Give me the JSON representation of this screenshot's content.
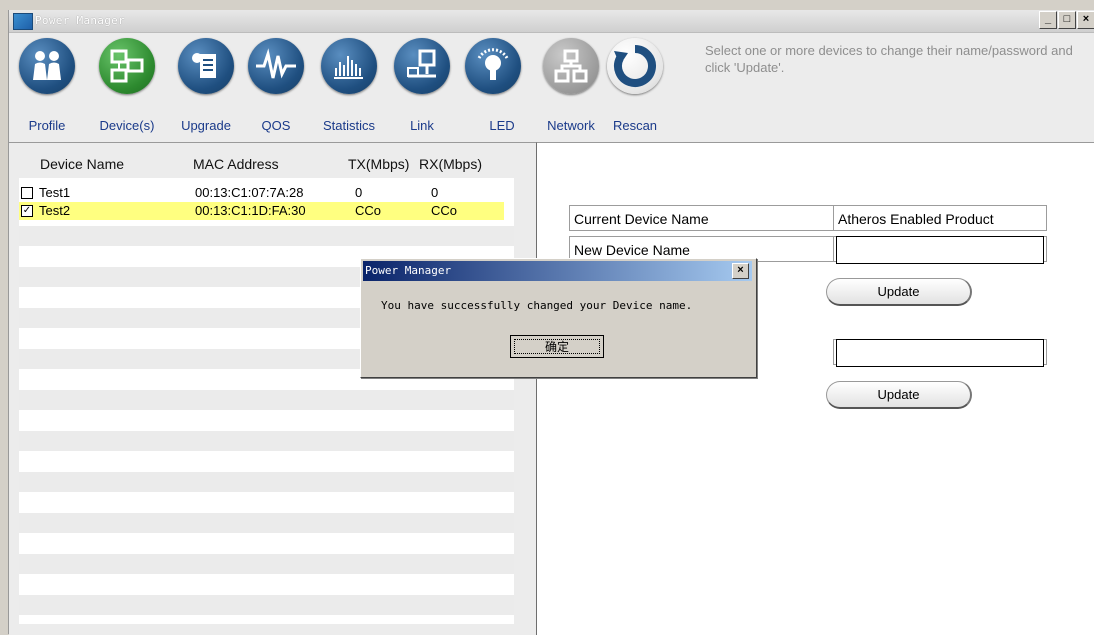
{
  "window": {
    "title": "Power Manager"
  },
  "toolbar": {
    "items": [
      {
        "label": "Profile",
        "icon": "profile-people-icon"
      },
      {
        "label": "Device(s)",
        "icon": "devices-icon"
      },
      {
        "label": "Upgrade",
        "icon": "upgrade-icon"
      },
      {
        "label": "QOS",
        "icon": "qos-waveform-icon"
      },
      {
        "label": "Statistics",
        "icon": "statistics-bars-icon"
      },
      {
        "label": "Link",
        "icon": "link-network-icon"
      },
      {
        "label": "LED",
        "icon": "led-bulb-icon"
      },
      {
        "label": "Network",
        "icon": "network-tree-icon"
      },
      {
        "label": "Rescan",
        "icon": "rescan-refresh-icon"
      }
    ]
  },
  "instructions": "Select one or more devices to change their name/password and click 'Update'.",
  "device_list": {
    "headers": {
      "name": "Device Name",
      "mac": "MAC Address",
      "tx": "TX(Mbps)",
      "rx": "RX(Mbps)"
    },
    "rows": [
      {
        "checked": false,
        "name": "Test1",
        "mac": "00:13:C1:07:7A:28",
        "tx": "0",
        "rx": "0"
      },
      {
        "checked": true,
        "name": "Test2",
        "mac": "00:13:C1:1D:FA:30",
        "tx": "CCo",
        "rx": "CCo"
      }
    ]
  },
  "details": {
    "current_name_label": "Current Device Name",
    "current_name_value": "Atheros Enabled Product",
    "new_name_label": "New Device Name",
    "update_label": "Update"
  },
  "dialog": {
    "title": "Power Manager",
    "message": "You have successfully changed your Device name.",
    "ok_label": "确定"
  },
  "colors": {
    "selected_row": "#ffff80",
    "link_text": "#1a3a8a",
    "dialog_title": "#0a246a"
  }
}
